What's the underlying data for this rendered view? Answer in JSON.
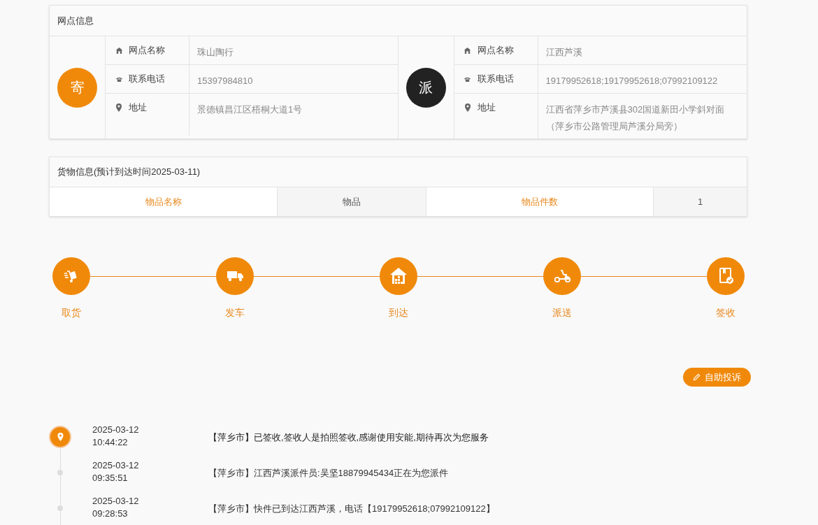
{
  "network_info": {
    "title": "网点信息",
    "sides": [
      {
        "kind": "send",
        "badge": "寄",
        "rows": [
          {
            "kind": "name",
            "label": "网点名称",
            "value": "珠山陶行"
          },
          {
            "kind": "phone",
            "label": "联系电话",
            "value": "15397984810"
          },
          {
            "kind": "address",
            "label": "地址",
            "value": "景德镇昌江区梧桐大道1号"
          }
        ]
      },
      {
        "kind": "deliver",
        "badge": "派",
        "rows": [
          {
            "kind": "name",
            "label": "网点名称",
            "value": "江西芦溪"
          },
          {
            "kind": "phone",
            "label": "联系电话",
            "value": "19179952618;19179952618;07992109122"
          },
          {
            "kind": "address",
            "label": "地址",
            "value": "江西省萍乡市芦溪县302国道新田小学斜对面（萍乡市公路管理局芦溪分局旁）"
          }
        ]
      }
    ]
  },
  "cargo_info": {
    "title": "货物信息(预计到达时间2025-03-11)",
    "cells": [
      {
        "kind": "label",
        "text": "物品名称"
      },
      {
        "kind": "value",
        "text": "物品"
      },
      {
        "kind": "label",
        "text": "物品件数"
      },
      {
        "kind": "value",
        "text": "1"
      }
    ]
  },
  "progress_steps": [
    {
      "kind": "pickup",
      "label": "取货"
    },
    {
      "kind": "depart",
      "label": "发车"
    },
    {
      "kind": "arrive",
      "label": "到达"
    },
    {
      "kind": "deliver",
      "label": "派送"
    },
    {
      "kind": "sign",
      "label": "签收"
    }
  ],
  "complaint_button": "自助投诉",
  "tracking_events": [
    {
      "current": true,
      "date": "2025-03-12",
      "time": "10:44:22",
      "text": "【萍乡市】已签收,签收人是拍照签收,感谢使用安能,期待再次为您服务"
    },
    {
      "current": false,
      "date": "2025-03-12",
      "time": "09:35:51",
      "text": "【萍乡市】江西芦溪派件员:吴坚18879945434正在为您派件"
    },
    {
      "current": false,
      "date": "2025-03-12",
      "time": "09:28:53",
      "text": "【萍乡市】快件已到达江西芦溪，电话【19179952618;07992109122】"
    }
  ]
}
